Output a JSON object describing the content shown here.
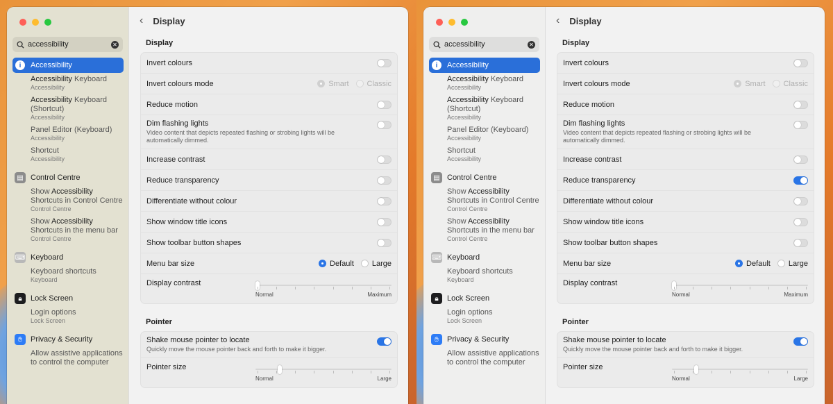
{
  "screens": [
    {
      "search": {
        "value": "accessibility"
      },
      "results": {
        "accessibility": {
          "label": "Accessibility",
          "items": [
            {
              "title_bold": "Accessibility",
              "title_rest": " Keyboard",
              "category": "Accessibility"
            },
            {
              "title_bold": "Accessibility",
              "title_rest": " Keyboard (Shortcut)",
              "category": "Accessibility"
            },
            {
              "title_bold": "",
              "title_rest": "Panel Editor (Keyboard)",
              "category": "Accessibility"
            },
            {
              "title_bold": "",
              "title_rest": "Shortcut",
              "category": "Accessibility"
            }
          ]
        },
        "control_centre": {
          "label": "Control Centre",
          "items": [
            {
              "title_pre": "Show ",
              "title_bold": "Accessibility",
              "title_rest": " Shortcuts in Control Centre",
              "category": "Control Centre"
            },
            {
              "title_pre": "Show ",
              "title_bold": "Accessibility",
              "title_rest": " Shortcuts in the menu bar",
              "category": "Control Centre"
            }
          ]
        },
        "keyboard": {
          "label": "Keyboard",
          "items": [
            {
              "title": "Keyboard shortcuts",
              "category": "Keyboard"
            }
          ]
        },
        "lock_screen": {
          "label": "Lock Screen",
          "items": [
            {
              "title": "Login options",
              "category": "Lock Screen"
            }
          ]
        },
        "privacy": {
          "label": "Privacy & Security",
          "items": [
            {
              "title": "Allow assistive applications to control the computer"
            }
          ]
        }
      },
      "header": {
        "title": "Display"
      },
      "display": {
        "section_title": "Display",
        "invert_colours": "Invert colours",
        "invert_colours_mode": "Invert colours mode",
        "mode_options": [
          "Smart",
          "Classic"
        ],
        "reduce_motion": "Reduce motion",
        "dim_flashing": "Dim flashing lights",
        "dim_flashing_desc": "Video content that depicts repeated flashing or strobing lights will be automatically dimmed.",
        "increase_contrast": "Increase contrast",
        "reduce_transparency": "Reduce transparency",
        "reduce_transparency_on": false,
        "differentiate": "Differentiate without colour",
        "window_title_icons": "Show window title icons",
        "toolbar_shapes": "Show toolbar button shapes",
        "menu_bar_size": "Menu bar size",
        "menu_bar_options": [
          "Default",
          "Large"
        ],
        "display_contrast": "Display contrast",
        "contrast_min": "Normal",
        "contrast_max": "Maximum",
        "contrast_value": 0
      },
      "pointer": {
        "section_title": "Pointer",
        "shake": "Shake mouse pointer to locate",
        "shake_desc": "Quickly move the mouse pointer back and forth to make it bigger.",
        "pointer_size": "Pointer size",
        "size_min": "Normal",
        "size_max": "Large",
        "size_value": 0.17
      }
    },
    {
      "search": {
        "value": "accessibility"
      },
      "results": {
        "accessibility": {
          "label": "Accessibility",
          "items": [
            {
              "title_bold": "Accessibility",
              "title_rest": " Keyboard",
              "category": "Accessibility"
            },
            {
              "title_bold": "Accessibility",
              "title_rest": " Keyboard (Shortcut)",
              "category": "Accessibility"
            },
            {
              "title_bold": "",
              "title_rest": "Panel Editor (Keyboard)",
              "category": "Accessibility"
            },
            {
              "title_bold": "",
              "title_rest": "Shortcut",
              "category": "Accessibility"
            }
          ]
        },
        "control_centre": {
          "label": "Control Centre",
          "items": [
            {
              "title_pre": "Show ",
              "title_bold": "Accessibility",
              "title_rest": " Shortcuts in Control Centre",
              "category": "Control Centre"
            },
            {
              "title_pre": "Show ",
              "title_bold": "Accessibility",
              "title_rest": " Shortcuts in the menu bar",
              "category": "Control Centre"
            }
          ]
        },
        "keyboard": {
          "label": "Keyboard",
          "items": [
            {
              "title": "Keyboard shortcuts",
              "category": "Keyboard"
            }
          ]
        },
        "lock_screen": {
          "label": "Lock Screen",
          "items": [
            {
              "title": "Login options",
              "category": "Lock Screen"
            }
          ]
        },
        "privacy": {
          "label": "Privacy & Security",
          "items": [
            {
              "title": "Allow assistive applications to control the computer"
            }
          ]
        }
      },
      "header": {
        "title": "Display"
      },
      "display": {
        "section_title": "Display",
        "invert_colours": "Invert colours",
        "invert_colours_mode": "Invert colours mode",
        "mode_options": [
          "Smart",
          "Classic"
        ],
        "reduce_motion": "Reduce motion",
        "dim_flashing": "Dim flashing lights",
        "dim_flashing_desc": "Video content that depicts repeated flashing or strobing lights will be automatically dimmed.",
        "increase_contrast": "Increase contrast",
        "reduce_transparency": "Reduce transparency",
        "reduce_transparency_on": true,
        "differentiate": "Differentiate without colour",
        "window_title_icons": "Show window title icons",
        "toolbar_shapes": "Show toolbar button shapes",
        "menu_bar_size": "Menu bar size",
        "menu_bar_options": [
          "Default",
          "Large"
        ],
        "display_contrast": "Display contrast",
        "contrast_min": "Normal",
        "contrast_max": "Maximum",
        "contrast_value": 0
      },
      "pointer": {
        "section_title": "Pointer",
        "shake": "Shake mouse pointer to locate",
        "shake_desc": "Quickly move the mouse pointer back and forth to make it bigger.",
        "pointer_size": "Pointer size",
        "size_min": "Normal",
        "size_max": "Large",
        "size_value": 0.17
      }
    }
  ],
  "colors": {
    "accent": "#2a75e6",
    "selection": "#2a6fd9"
  },
  "icons": [
    "search-icon",
    "clear-search-icon",
    "accessibility-icon",
    "control-centre-icon",
    "keyboard-icon",
    "lock-icon",
    "hand-icon",
    "chevron-left-icon"
  ]
}
